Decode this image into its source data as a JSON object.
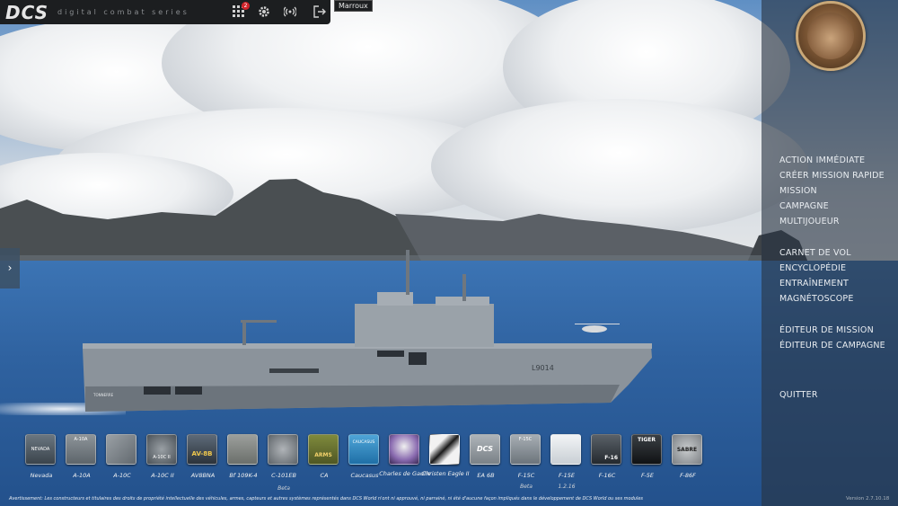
{
  "topbar": {
    "logo": "DCS",
    "subtitle": "digital combat series",
    "icons": [
      "modules-grid-icon",
      "gear-icon",
      "signal-icon",
      "exit-icon"
    ],
    "notification_count": "2",
    "tooltip": "Marroux"
  },
  "colors": {
    "topbar_bg": "#1c1e20",
    "badge": "#d2232a",
    "panel_bg": "#28344a"
  },
  "menu": {
    "items": [
      "ACTION IMMÉDIATE",
      "CRÉER MISSION RAPIDE",
      "MISSION",
      "CAMPAGNE",
      "MULTIJOUEUR",
      "CARNET DE VOL",
      "ENCYCLOPÉDIE",
      "ENTRAÎNEMENT",
      "MAGNÉTOSCOPE",
      "ÉDITEUR DE MISSION",
      "ÉDITEUR DE CAMPAGNE",
      "QUITTER"
    ]
  },
  "side_toggle": "›",
  "ship": {
    "hull_number": "L9014",
    "name": "TONNERRE"
  },
  "modules": [
    {
      "label": "Nevada",
      "icon": "NEVADA",
      "sub": ""
    },
    {
      "label": "A-10A",
      "icon": "A-10A",
      "sub": ""
    },
    {
      "label": "A-10C",
      "icon": "",
      "sub": ""
    },
    {
      "label": "A-10C II",
      "icon": "A-10C II",
      "sub": ""
    },
    {
      "label": "AV8BNA",
      "icon": "AV-8B",
      "sub": ""
    },
    {
      "label": "Bf 109K-4",
      "icon": "",
      "sub": ""
    },
    {
      "label": "C-101EB",
      "icon": "",
      "sub": "Beta"
    },
    {
      "label": "CA",
      "icon": "ARMS",
      "sub": ""
    },
    {
      "label": "Caucasus",
      "icon": "CAUCASUS",
      "sub": ""
    },
    {
      "label": "Charles de Gaulle",
      "icon": "",
      "sub": ""
    },
    {
      "label": "Christen Eagle II",
      "icon": "",
      "sub": ""
    },
    {
      "label": "EA 6B",
      "icon": "DCS",
      "sub": ""
    },
    {
      "label": "F-15C",
      "icon": "F-15C",
      "sub": "Beta"
    },
    {
      "label": "F-15E",
      "icon": "",
      "sub": "1.2.16"
    },
    {
      "label": "F-16C",
      "icon": "F-16",
      "sub": ""
    },
    {
      "label": "F-5E",
      "icon": "TIGER",
      "sub": ""
    },
    {
      "label": "F-86F",
      "icon": "SABRE",
      "sub": ""
    }
  ],
  "disclaimer": "Avertissement: Les constructeurs et titulaires des droits de propriété intellectuelle des véhicules, armes, capteurs et autres systèmes représentés dans DCS World n'ont ni approuvé, ni parrainé, ni été d'aucune façon impliqués dans le développement de DCS World ou ses modules",
  "version": "Version 2.7.10.18"
}
